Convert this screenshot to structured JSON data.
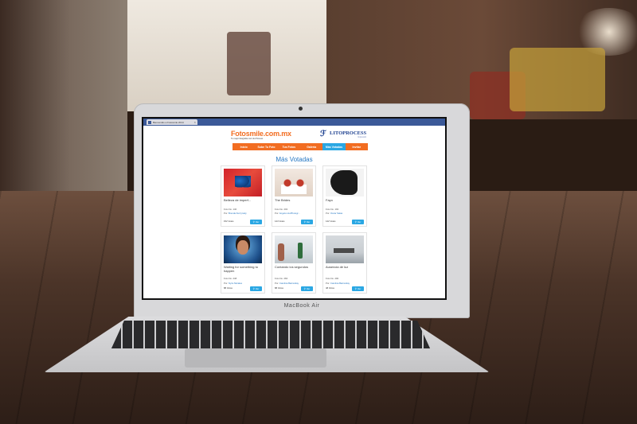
{
  "browser": {
    "tab_title": "Bienvenido a Fotosmile 2014",
    "tab_close": "×"
  },
  "site": {
    "logo_left": "Fotosmile.com.mx",
    "logo_left_sub": "Tu mejor fotografía con Lito Process",
    "logo_right": "LITOPROCESS",
    "logo_right_sub": "Impresión"
  },
  "nav": {
    "items": [
      "Inicio",
      "Sube Tu Foto",
      "Tus Fotos",
      "Galería",
      "Más Votadas",
      "Invitar"
    ],
    "active_index": 4
  },
  "page": {
    "title": "Más Votadas"
  },
  "cards": [
    {
      "title": "Belleza de imperf...",
      "foto_no": "Foto No. 140",
      "por_label": "Por:",
      "author": "Brenda Kurzynsky",
      "votes": "152 Votos",
      "button": "Ver",
      "image": "butterfly"
    },
    {
      "title": "The Brides",
      "foto_no": "Foto No. 202",
      "por_label": "Por:",
      "author": "Angelo LitoPhotogr...",
      "votes": "144 Votos",
      "button": "Ver",
      "image": "brides"
    },
    {
      "title": "Fayo",
      "foto_no": "Foto No. 192",
      "por_label": "Por:",
      "author": "Oscar Salas",
      "votes": "142 Votos",
      "button": "Ver",
      "image": "horse"
    },
    {
      "title": "Waiting for something to happen",
      "foto_no": "Foto No. 248",
      "por_label": "Por:",
      "author": "Nyze Morales",
      "votes": "88 Votos",
      "button": "Ver",
      "image": "face"
    },
    {
      "title": "Contando los segundos",
      "foto_no": "Foto No. 284",
      "por_label": "Por:",
      "author": "Carolina Barranday",
      "votes": "88 Votos",
      "button": "Ver",
      "image": "beach"
    },
    {
      "title": "Ausencia de luz",
      "foto_no": "Foto No. 290",
      "por_label": "Por:",
      "author": "Carolina Barranday",
      "votes": "48 Votos",
      "button": "Ver",
      "image": "pier"
    }
  ],
  "laptop": {
    "brand": "MacBook Air"
  },
  "colors": {
    "nav_orange": "#f26d21",
    "accent_blue": "#2aa7e3",
    "title_blue": "#2577c3",
    "browser_bar": "#3b5998"
  }
}
